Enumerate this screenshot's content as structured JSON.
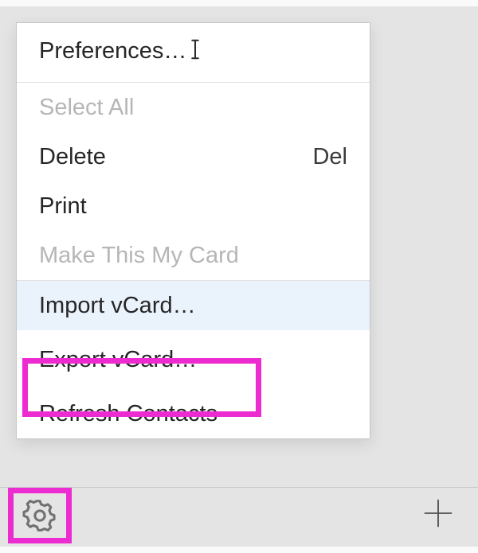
{
  "menu": {
    "preferences": "Preferences…",
    "selectAll": "Select All",
    "delete": "Delete",
    "deleteShortcut": "Del",
    "print": "Print",
    "makeMyCard": "Make This My Card",
    "importVcard": "Import vCard…",
    "exportVcard": "Export vCard…",
    "refreshContacts": "Refresh Contacts"
  },
  "annotations": {
    "highlightColor": "#ec2bd0",
    "exportHighlighted": true,
    "gearHighlighted": true
  },
  "icons": {
    "gear": "gear-icon",
    "plus": "plus-icon",
    "textCursor": "text-cursor-icon"
  }
}
